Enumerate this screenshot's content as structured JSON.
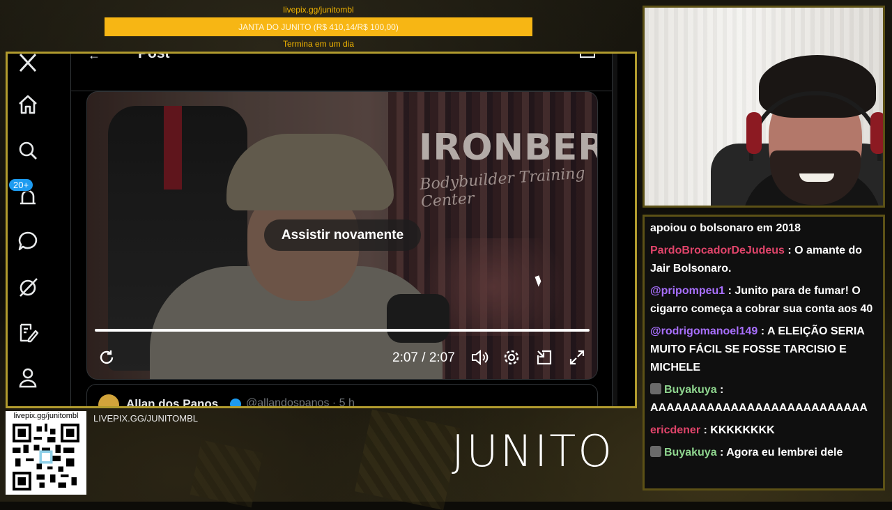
{
  "overlay": {
    "goal_url": "livepix.gg/junitombl",
    "goal_text": "JANTA DO JUNITO (R$ 410,14/R$ 100,00)",
    "goal_ends": "Termina em um dia",
    "qr_url": "livepix.gg/junitombl",
    "livepix_caption": "LIVEPIX.GG/JUNITOMBL",
    "brand_logo": "JUNITO",
    "accent_color": "#f7b614",
    "frame_color": "#b19b2e"
  },
  "x_app": {
    "sidebar": {
      "items": [
        {
          "icon": "x-logo-icon"
        },
        {
          "icon": "home-icon"
        },
        {
          "icon": "search-icon"
        },
        {
          "icon": "bell-icon",
          "badge": "20+"
        },
        {
          "icon": "chat-bubble-icon"
        },
        {
          "icon": "grok-icon"
        },
        {
          "icon": "compose-icon"
        },
        {
          "icon": "profile-icon"
        }
      ]
    },
    "header": {
      "title": "Post"
    },
    "video": {
      "brand_text": "IRONBERG",
      "brand_subtext": "Bodybuilder Training Center",
      "replay_label": "Assistir novamente",
      "time_readout": "2:07 / 2:07",
      "progress": 1.0
    },
    "reply_preview": {
      "name": "Allan dos Panos",
      "handle": "@allandospanos · 5 h"
    }
  },
  "chat": {
    "messages": [
      {
        "user": "",
        "color": "#ffffff",
        "text": "apoiou o bolsonaro em 2018",
        "badge": false
      },
      {
        "user": "PardoBrocadorDeJudeus",
        "color": "#e0446a",
        "text": ": O amante do Jair Bolsonaro.",
        "badge": false
      },
      {
        "user": "@pripompeu1",
        "color": "#a970ff",
        "text": ": Junito para de fumar! O cigarro começa a cobrar sua conta aos 40",
        "badge": false
      },
      {
        "user": "@rodrigomanoel149",
        "color": "#a970ff",
        "text": ": A ELEIÇÃO SERIA MUITO FÁCIL SE FOSSE TARCISIO E MICHELE",
        "badge": false
      },
      {
        "user": "Buyakuya",
        "color": "#8fd68f",
        "text": ": AAAAAAAAAAAAAAAAAAAAAAAAAAA",
        "badge": true
      },
      {
        "user": "ericdener",
        "color": "#e0446a",
        "text": ": KKKKKKKK",
        "badge": false
      },
      {
        "user": "Buyakuya",
        "color": "#8fd68f",
        "text": ": Agora eu lembrei dele",
        "badge": true
      }
    ]
  }
}
